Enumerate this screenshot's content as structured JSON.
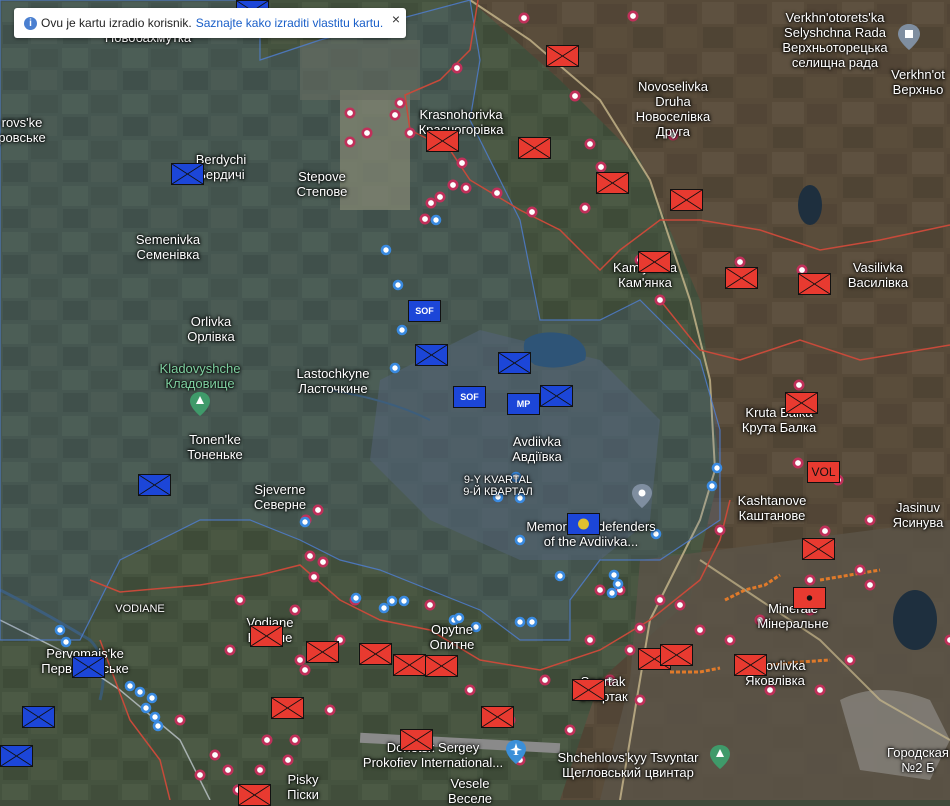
{
  "notice": {
    "text": "Ovu je kartu izradio korisnik.",
    "link": "Saznajte kako izraditi vlastitu kartu.",
    "close": "×"
  },
  "colors": {
    "russian_unit": "#e83a30",
    "ukrainian_unit": "#1c46d8",
    "ru_marker": "#ffffff",
    "ua_marker": "#4aa8ff",
    "frontline": "#c84a3a",
    "ua_area": "#4f7fd6",
    "trench": "#e07a2a"
  },
  "places": {
    "novobakhmutka": "Новобахмутка",
    "verkhnotoretska_1": "Verkhn'otorets'ka",
    "verkhnotoretska_2": "Selyshchna Rada",
    "verkhnotoretska_3": "Верхньоторецька",
    "verkhnotoretska_4": "селищна рада",
    "verkhn_1": "Verkhn'ot",
    "verkhn_2": "Верхньо",
    "novoselivka_1": "Novoselivka",
    "novoselivka_2": "Druha",
    "novoselivka_3": "Новоселівка",
    "novoselivka_4": "Друга",
    "krasnohorivka_1": "Krasnohorivka",
    "krasnohorivka_2": "Красногорівка",
    "orovske_1": "rovs'ke",
    "orovske_2": "ровське",
    "berdychi_1": "Berdychi",
    "berdychi_2": "Бердичі",
    "stepove_1": "Stepove",
    "stepove_2": "Степове",
    "semenivka_1": "Semenivka",
    "semenivka_2": "Семенівка",
    "kamianka_1": "Kam'yanka",
    "kamianka_2": "Кам'янка",
    "vasilivka_1": "Vasilivka",
    "vasilivka_2": "Василівка",
    "orlivka_1": "Orlivka",
    "orlivka_2": "Орлівка",
    "kladovyshche_1": "Kladovyshche",
    "kladovyshche_2": "Кладовище",
    "lastochkyne_1": "Lastochkyne",
    "lastochkyne_2": "Ласточкине",
    "kruta_balka_1": "Kruta Balka",
    "kruta_balka_2": "Крута Балка",
    "tonenke_1": "Tonen'ke",
    "tonenke_2": "Тоненьке",
    "avdiivka_1": "Avdiivka",
    "avdiivka_2": "Авдіївка",
    "kvartal_1": "9-Y KVARTAL",
    "kvartal_2": "9-Й КВАРТАЛ",
    "kashtanove_1": "Kashtanove",
    "kashtanove_2": "Каштанове",
    "jasinuvata_1": "Jasinuv",
    "jasinuvata_2": "Ясинува",
    "sjeverne_1": "Sjeverne",
    "sjeverne_2": "Северне",
    "memorial_1": "Memorial to defenders",
    "memorial_2": "of the Avdiivka...",
    "vodiane_small": "VODIANE",
    "vodiane_1": "Vodiane",
    "vodiane_2": "Водяне",
    "minerale_1": "Minerale",
    "minerale_2": "Мінеральне",
    "opytne_1": "Opytne",
    "opytne_2": "Опитне",
    "pervomaiske_1": "Pervomais'ke",
    "pervomaiske_2": "Первомайське",
    "spartak_1": "Spartak",
    "spartak_2": "Спартак",
    "yakovlivka_1": "Yakovlivka",
    "yakovlivka_2": "Яковлівка",
    "airport_1": "Donetsk Sergey",
    "airport_2": "Prokofiev International...",
    "shchehlov_1": "Shchehlovs'kyy Tsvyntar",
    "shchehlov_2": "Щегловський цвинтар",
    "horodska_1": "Городская",
    "horodska_2": "№2 Б",
    "pisky_1": "Pisky",
    "pisky_2": "Піски",
    "vesele_1": "Vesele",
    "vesele_2": "Веселе"
  },
  "unit_text": {
    "sof": "SOF",
    "mp": "MP",
    "vol": "VOL"
  }
}
